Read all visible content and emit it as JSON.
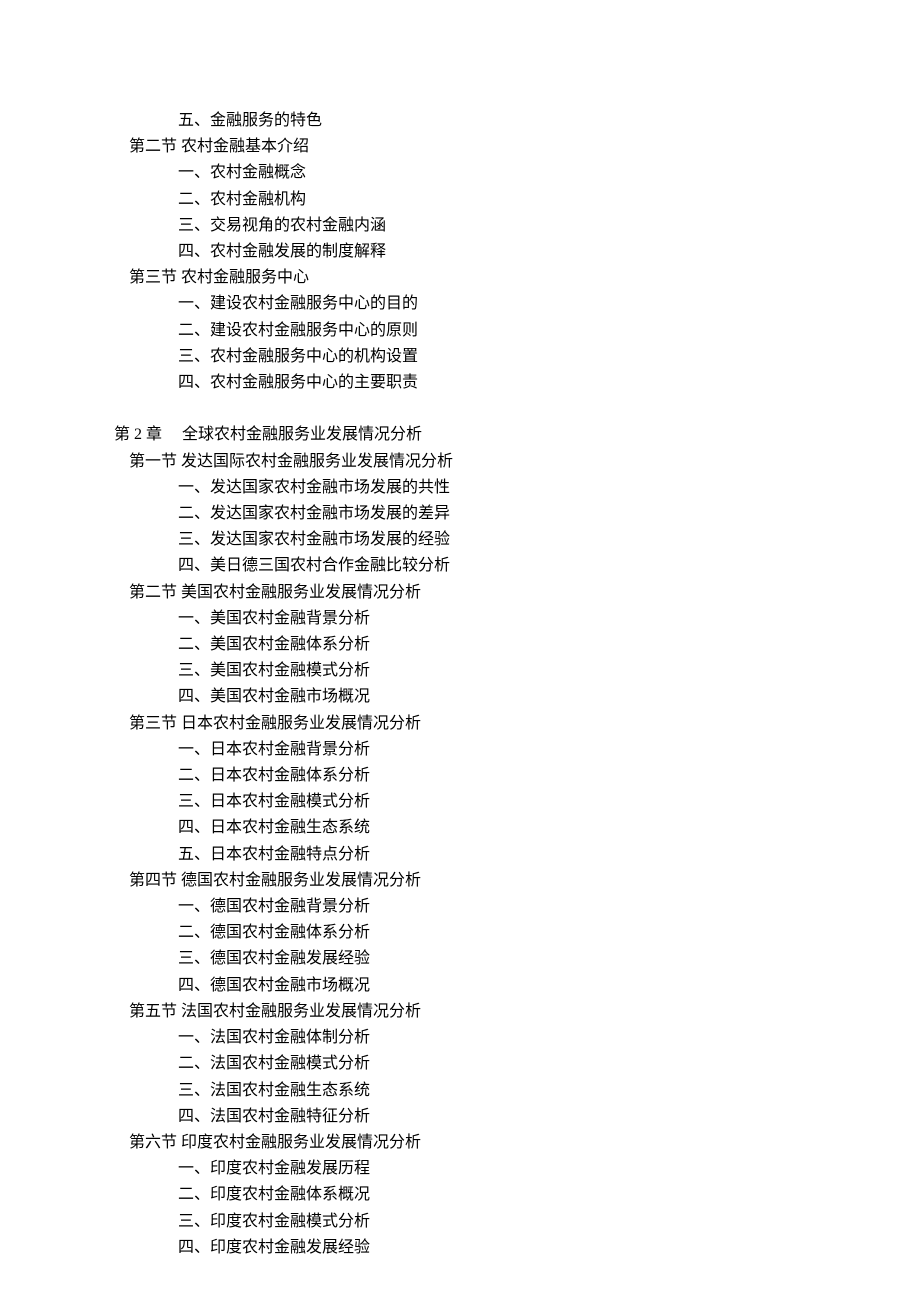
{
  "lines": [
    {
      "level": 3,
      "text": "五、金融服务的特色"
    },
    {
      "level": 2,
      "text": "第二节 农村金融基本介绍"
    },
    {
      "level": 3,
      "text": "一、农村金融概念"
    },
    {
      "level": 3,
      "text": "二、农村金融机构"
    },
    {
      "level": 3,
      "text": "三、交易视角的农村金融内涵"
    },
    {
      "level": 3,
      "text": "四、农村金融发展的制度解释"
    },
    {
      "level": 2,
      "text": "第三节 农村金融服务中心"
    },
    {
      "level": 3,
      "text": "一、建设农村金融服务中心的目的"
    },
    {
      "level": 3,
      "text": "二、建设农村金融服务中心的原则"
    },
    {
      "level": 3,
      "text": "三、农村金融服务中心的机构设置"
    },
    {
      "level": 3,
      "text": "四、农村金融服务中心的主要职责"
    },
    {
      "level": "blank"
    },
    {
      "level": 1,
      "text": "第 2 章　 全球农村金融服务业发展情况分析"
    },
    {
      "level": 2,
      "text": "第一节 发达国际农村金融服务业发展情况分析"
    },
    {
      "level": 3,
      "text": "一、发达国家农村金融市场发展的共性"
    },
    {
      "level": 3,
      "text": "二、发达国家农村金融市场发展的差异"
    },
    {
      "level": 3,
      "text": "三、发达国家农村金融市场发展的经验"
    },
    {
      "level": 3,
      "text": "四、美日德三国农村合作金融比较分析"
    },
    {
      "level": 2,
      "text": "第二节 美国农村金融服务业发展情况分析"
    },
    {
      "level": 3,
      "text": "一、美国农村金融背景分析"
    },
    {
      "level": 3,
      "text": "二、美国农村金融体系分析"
    },
    {
      "level": 3,
      "text": "三、美国农村金融模式分析"
    },
    {
      "level": 3,
      "text": "四、美国农村金融市场概况"
    },
    {
      "level": 2,
      "text": "第三节 日本农村金融服务业发展情况分析"
    },
    {
      "level": 3,
      "text": "一、日本农村金融背景分析"
    },
    {
      "level": 3,
      "text": "二、日本农村金融体系分析"
    },
    {
      "level": 3,
      "text": "三、日本农村金融模式分析"
    },
    {
      "level": 3,
      "text": "四、日本农村金融生态系统"
    },
    {
      "level": 3,
      "text": "五、日本农村金融特点分析"
    },
    {
      "level": 2,
      "text": "第四节 德国农村金融服务业发展情况分析"
    },
    {
      "level": 3,
      "text": "一、德国农村金融背景分析"
    },
    {
      "level": 3,
      "text": "二、德国农村金融体系分析"
    },
    {
      "level": 3,
      "text": "三、德国农村金融发展经验"
    },
    {
      "level": 3,
      "text": "四、德国农村金融市场概况"
    },
    {
      "level": 2,
      "text": "第五节 法国农村金融服务业发展情况分析"
    },
    {
      "level": 3,
      "text": "一、法国农村金融体制分析"
    },
    {
      "level": 3,
      "text": "二、法国农村金融模式分析"
    },
    {
      "level": 3,
      "text": "三、法国农村金融生态系统"
    },
    {
      "level": 3,
      "text": "四、法国农村金融特征分析"
    },
    {
      "level": 2,
      "text": "第六节 印度农村金融服务业发展情况分析"
    },
    {
      "level": 3,
      "text": "一、印度农村金融发展历程"
    },
    {
      "level": 3,
      "text": "二、印度农村金融体系概况"
    },
    {
      "level": 3,
      "text": "三、印度农村金融模式分析"
    },
    {
      "level": 3,
      "text": "四、印度农村金融发展经验"
    }
  ]
}
